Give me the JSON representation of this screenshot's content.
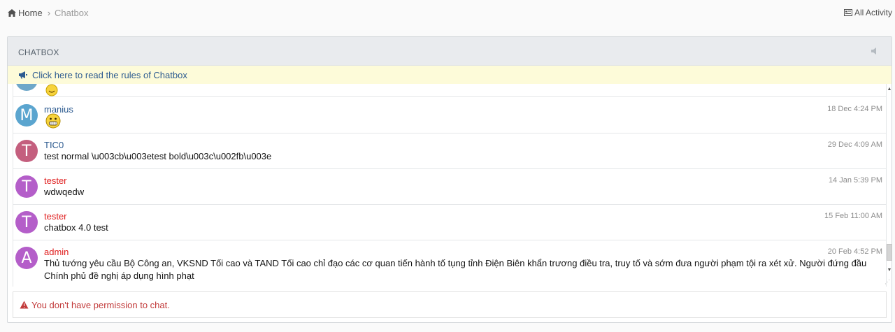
{
  "breadcrumb": {
    "home": "Home",
    "current": "Chatbox"
  },
  "header_link": "All Activity",
  "panel": {
    "title": "CHATBOX",
    "rules_link": "Click here to read the rules of Chatbox"
  },
  "colors": {
    "member": "#2d5b90",
    "admin_group": "#e02020",
    "accent": "#2d5b90"
  },
  "messages": [
    {
      "avatar_letter": "M",
      "user": "manius",
      "time": "18 Dec 4:24 PM",
      "text": "",
      "emoji": "grin"
    },
    {
      "avatar_letter": "T",
      "user": "TIC0",
      "time": "29 Dec 4:09 AM",
      "text": "test normal \\u003cb\\u003etest bold\\u003c\\u002fb\\u003e"
    },
    {
      "avatar_letter": "T",
      "user": "tester",
      "time": "14 Jan 5:39 PM",
      "text": "wdwqedw"
    },
    {
      "avatar_letter": "T",
      "user": "tester",
      "time": "15 Feb 11:00 AM",
      "text": "chatbox 4.0 test"
    },
    {
      "avatar_letter": "A",
      "user": "admin",
      "time": "20 Feb 4:52 PM",
      "text": "Thủ tướng yêu cầu Bộ Công an, VKSND Tối cao và TAND Tối cao chỉ đạo các cơ quan tiến hành tố tụng tỉnh Điện Biên khẩn trương điều tra, truy tố và sớm đưa người phạm tội ra xét xử. Người đứng đầu Chính phủ đề nghị áp dụng hình phạt"
    }
  ],
  "permission_notice": "You don't have permission to chat."
}
